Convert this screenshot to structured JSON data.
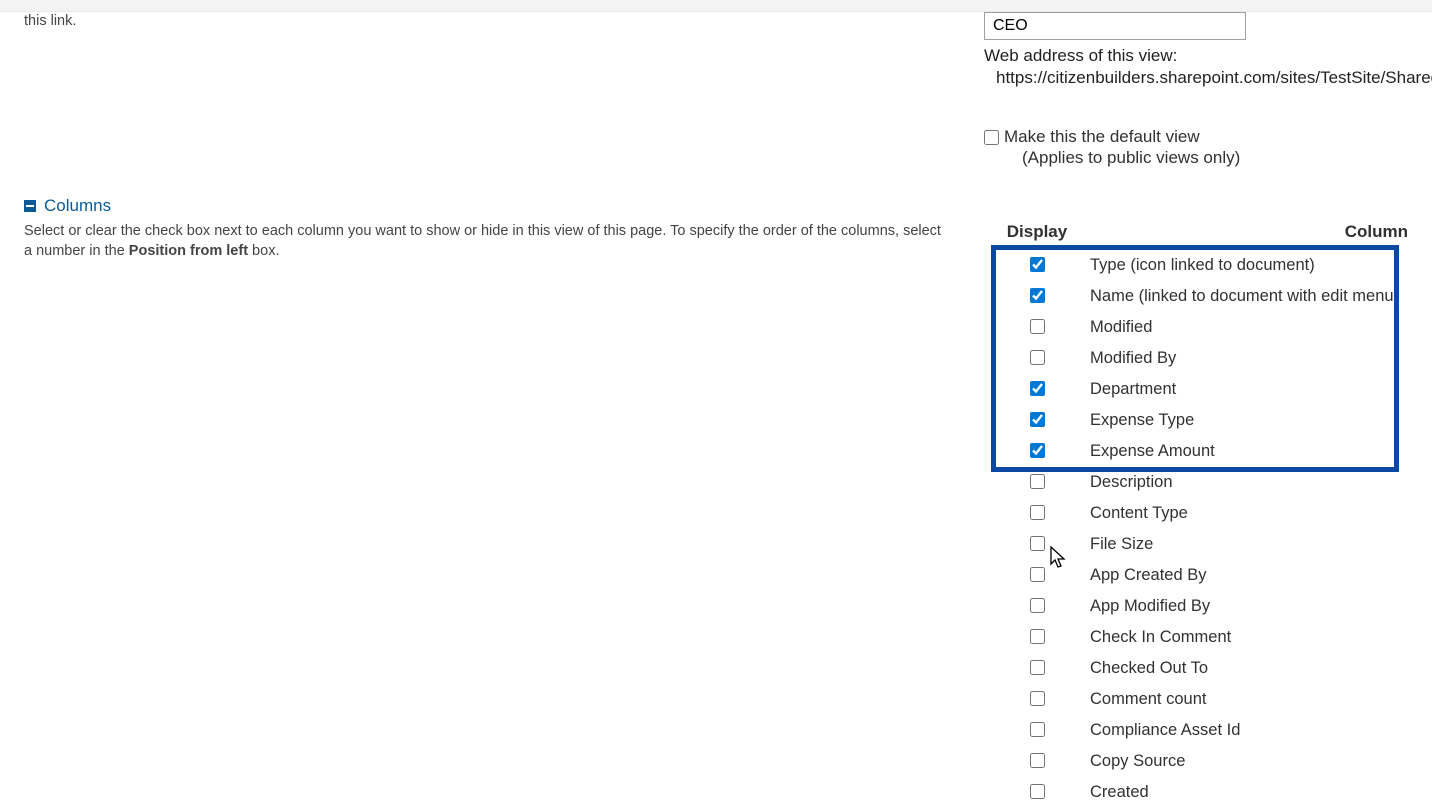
{
  "name_section": {
    "description_fragment": "this link.",
    "view_name_value": "CEO",
    "web_address_label": "Web address of this view:",
    "web_address_url": "https://citizenbuilders.sharepoint.com/sites/TestSite/Shared Do",
    "default_view_label": "Make this the default view",
    "default_view_note": "(Applies to public views only)",
    "default_view_checked": false
  },
  "columns_section": {
    "title": "Columns",
    "description_part1": "Select or clear the check box next to each column you want to show or hide in this view of this page. To specify the order of the columns, select a number in the ",
    "description_bold": "Position from left",
    "description_part2": " box.",
    "header_display": "Display",
    "header_column_name": "Column",
    "columns": [
      {
        "name": "Type (icon linked to document)",
        "checked": true
      },
      {
        "name": "Name (linked to document with edit menu)",
        "checked": true
      },
      {
        "name": "Modified",
        "checked": false
      },
      {
        "name": "Modified By",
        "checked": false
      },
      {
        "name": "Department",
        "checked": true
      },
      {
        "name": "Expense Type",
        "checked": true
      },
      {
        "name": "Expense Amount",
        "checked": true
      },
      {
        "name": "Description",
        "checked": false
      },
      {
        "name": "Content Type",
        "checked": false
      },
      {
        "name": "File Size",
        "checked": false
      },
      {
        "name": "App Created By",
        "checked": false
      },
      {
        "name": "App Modified By",
        "checked": false
      },
      {
        "name": "Check In Comment",
        "checked": false
      },
      {
        "name": "Checked Out To",
        "checked": false
      },
      {
        "name": "Comment count",
        "checked": false
      },
      {
        "name": "Compliance Asset Id",
        "checked": false
      },
      {
        "name": "Copy Source",
        "checked": false
      },
      {
        "name": "Created",
        "checked": false
      }
    ]
  }
}
